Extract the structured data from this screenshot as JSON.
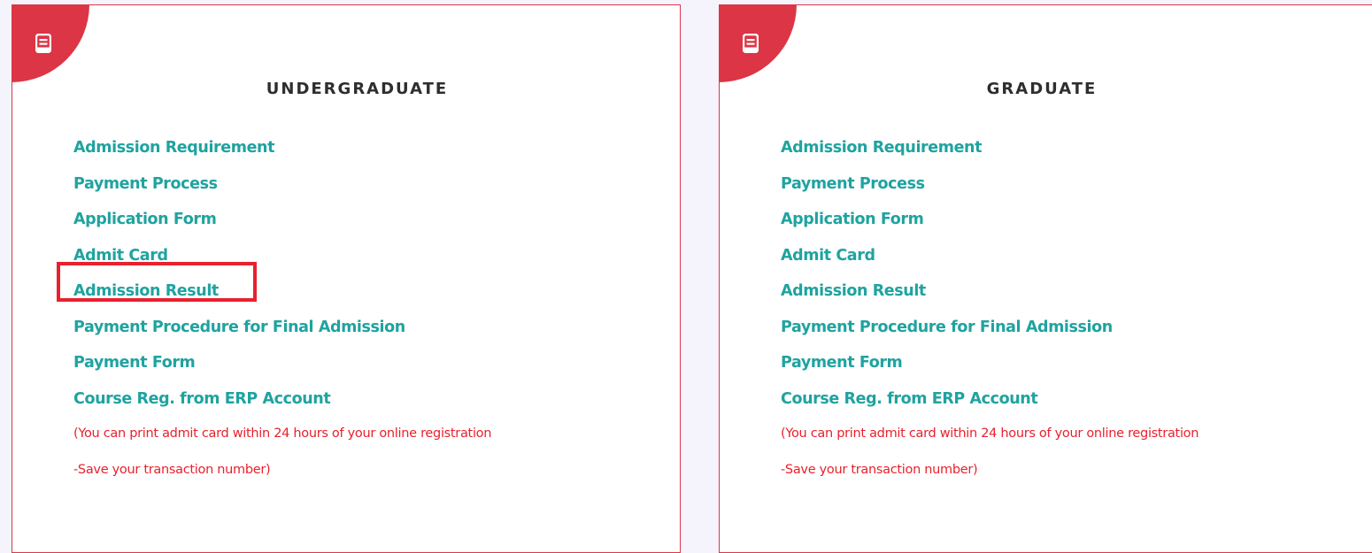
{
  "colors": {
    "page_background": "#f5f3fb",
    "card_border": "#d9374a",
    "corner_badge": "#dc3545",
    "link": "#1fa3a0",
    "note": "#e8212d",
    "title": "#2e2e2e",
    "highlight": "#e8212d"
  },
  "cards": [
    {
      "icon": "book-icon",
      "title": "UNDERGRADUATE",
      "links": [
        "Admission Requirement",
        "Payment Process",
        "Application Form",
        "Admit Card",
        "Admission Result",
        "Payment Procedure for Final Admission",
        "Payment Form",
        "Course Reg. from ERP Account"
      ],
      "note_line_1": "(You can print admit card within 24 hours of your online registration",
      "note_line_2": "-Save your transaction number)"
    },
    {
      "icon": "book-icon",
      "title": "GRADUATE",
      "links": [
        "Admission Requirement",
        "Payment Process",
        "Application Form",
        "Admit Card",
        "Admission Result",
        "Payment Procedure for Final Admission",
        "Payment Form",
        "Course Reg. from ERP Account"
      ],
      "note_line_1": "(You can print admit card within 24 hours of your online registration",
      "note_line_2": "-Save your transaction number)"
    }
  ]
}
